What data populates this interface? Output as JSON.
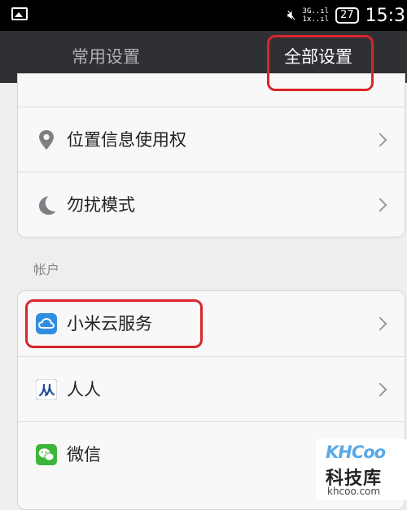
{
  "status_bar": {
    "network_top": "3G..ıl",
    "network_bottom": "1x..ıl",
    "battery": "27",
    "time": "15:3",
    "icons": [
      "picture-icon",
      "mute-icon"
    ]
  },
  "tabs": [
    {
      "label": "常用设置",
      "selected": false
    },
    {
      "label": "全部设置",
      "selected": true
    }
  ],
  "card1": {
    "rows": [
      {
        "label": "位置信息使用权",
        "icon": "location-pin-icon"
      },
      {
        "label": "勿扰模式",
        "icon": "moon-icon"
      }
    ]
  },
  "accounts_section": {
    "title": "帐户",
    "rows": [
      {
        "label": "小米云服务",
        "icon": "cloud-icon"
      },
      {
        "label": "人人",
        "icon": "renren-icon"
      },
      {
        "label": "微信",
        "icon": "wechat-icon"
      }
    ]
  },
  "colors": {
    "annotation_red": "#d9252b",
    "header_bg": "#2e3034",
    "xiaomi_cloud_blue": "#2f8ee4",
    "wechat_green": "#3db53a"
  },
  "watermark": {
    "logo": "KHCoo",
    "name": "科技库",
    "url": "khcoo.com"
  }
}
